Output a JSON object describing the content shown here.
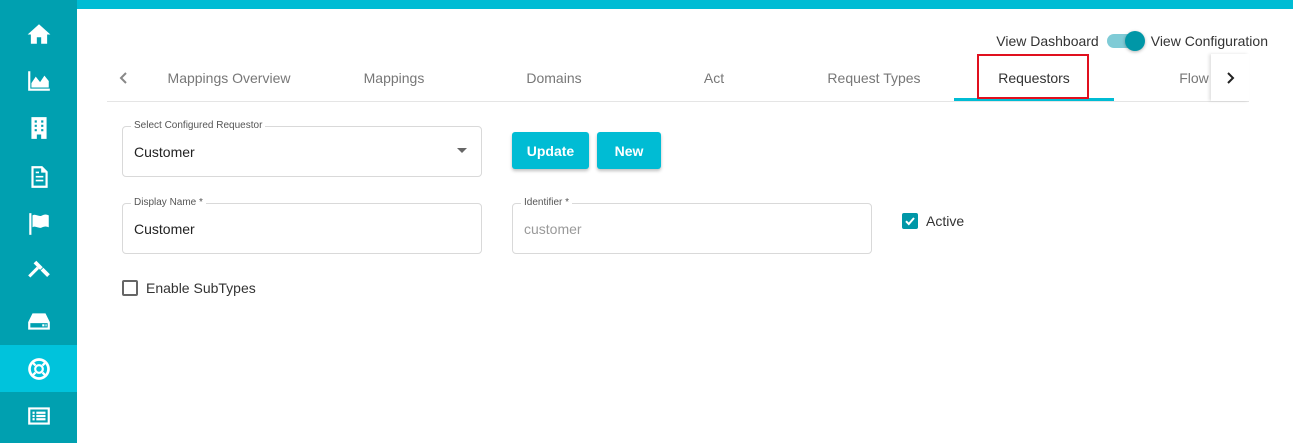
{
  "sidebar": {
    "items": [
      {
        "icon": "home-icon"
      },
      {
        "icon": "area-chart-icon"
      },
      {
        "icon": "building-icon"
      },
      {
        "icon": "document-icon"
      },
      {
        "icon": "flag-icon"
      },
      {
        "icon": "gavel-icon"
      },
      {
        "icon": "hard-drive-icon"
      },
      {
        "icon": "life-ring-icon",
        "active": true
      },
      {
        "icon": "list-icon"
      }
    ]
  },
  "view_toggle": {
    "left_label": "View Dashboard",
    "right_label": "View Configuration",
    "state": "View Configuration"
  },
  "tabs": {
    "items": [
      "Mappings Overview",
      "Mappings",
      "Domains",
      "Act",
      "Request Types",
      "Requestors",
      "Flow"
    ],
    "active": "Requestors"
  },
  "form": {
    "select_requestor": {
      "label": "Select Configured Requestor",
      "value": "Customer"
    },
    "update_label": "Update",
    "new_label": "New",
    "display_name": {
      "label": "Display Name *",
      "value": "Customer"
    },
    "identifier": {
      "label": "Identifier *",
      "value": "customer"
    },
    "active": {
      "label": "Active",
      "checked": true
    },
    "enable_subtypes": {
      "label": "Enable SubTypes",
      "checked": false
    }
  },
  "colors": {
    "sidebar": "#00a0b0",
    "sidebar_active": "#00c3dc",
    "accent": "#00bcd4",
    "highlight": "#e0101e"
  }
}
